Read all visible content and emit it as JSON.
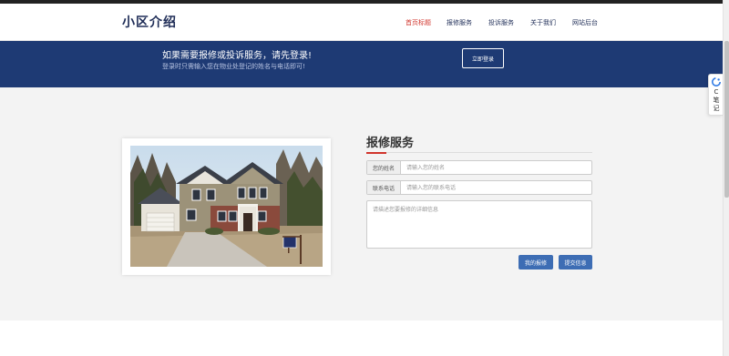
{
  "header": {
    "logo": "小区介绍",
    "nav": [
      {
        "label": "首页标题",
        "active": true
      },
      {
        "label": "报修服务",
        "active": false
      },
      {
        "label": "投诉服务",
        "active": false
      },
      {
        "label": "关于我们",
        "active": false
      },
      {
        "label": "网站后台",
        "active": false
      }
    ]
  },
  "banner": {
    "title": "如果需要报修或投诉服务，请先登录!",
    "subtitle": "登录时只需输入您在物业处登记的姓名与电话即可!",
    "login_label": "立即登录"
  },
  "service": {
    "title": "报修服务",
    "name_label": "您的姓名",
    "name_placeholder": "请输入您的姓名",
    "name_value": "",
    "phone_label": "联系电话",
    "phone_placeholder": "请输入您的联系电话",
    "phone_value": "",
    "detail_placeholder": "请描述您要报修的详细信息",
    "detail_value": "",
    "my_repairs_label": "我的报修",
    "submit_label": "提交信息"
  },
  "side_widget": {
    "icon": "c-note-icon",
    "text": "C 笔 记"
  },
  "colors": {
    "banner": "#1e3a74",
    "nav_active": "#d0342c",
    "button": "#3d6db4",
    "logo": "#1f2d57"
  }
}
